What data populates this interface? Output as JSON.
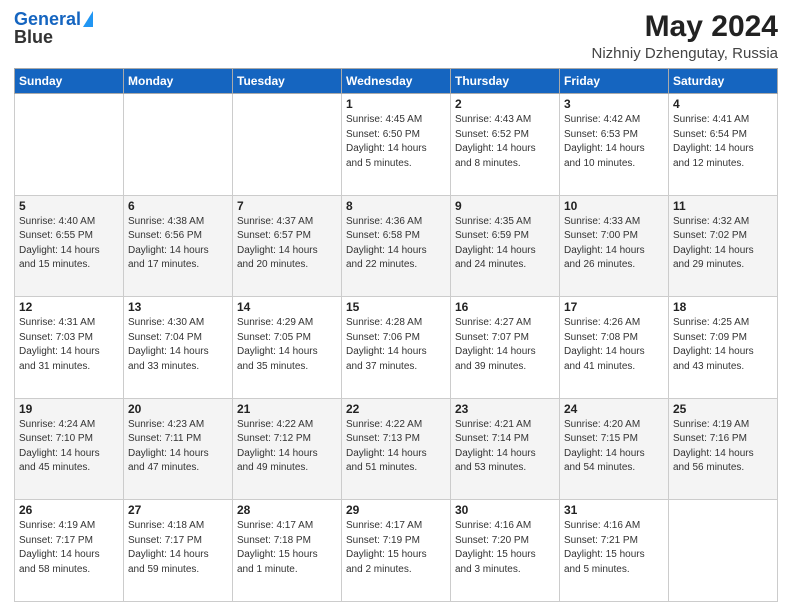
{
  "header": {
    "logo_general": "General",
    "logo_blue": "Blue",
    "month": "May 2024",
    "location": "Nizhniy Dzhengutay, Russia"
  },
  "weekdays": [
    "Sunday",
    "Monday",
    "Tuesday",
    "Wednesday",
    "Thursday",
    "Friday",
    "Saturday"
  ],
  "weeks": [
    [
      {
        "day": "",
        "info": ""
      },
      {
        "day": "",
        "info": ""
      },
      {
        "day": "",
        "info": ""
      },
      {
        "day": "1",
        "info": "Sunrise: 4:45 AM\nSunset: 6:50 PM\nDaylight: 14 hours\nand 5 minutes."
      },
      {
        "day": "2",
        "info": "Sunrise: 4:43 AM\nSunset: 6:52 PM\nDaylight: 14 hours\nand 8 minutes."
      },
      {
        "day": "3",
        "info": "Sunrise: 4:42 AM\nSunset: 6:53 PM\nDaylight: 14 hours\nand 10 minutes."
      },
      {
        "day": "4",
        "info": "Sunrise: 4:41 AM\nSunset: 6:54 PM\nDaylight: 14 hours\nand 12 minutes."
      }
    ],
    [
      {
        "day": "5",
        "info": "Sunrise: 4:40 AM\nSunset: 6:55 PM\nDaylight: 14 hours\nand 15 minutes."
      },
      {
        "day": "6",
        "info": "Sunrise: 4:38 AM\nSunset: 6:56 PM\nDaylight: 14 hours\nand 17 minutes."
      },
      {
        "day": "7",
        "info": "Sunrise: 4:37 AM\nSunset: 6:57 PM\nDaylight: 14 hours\nand 20 minutes."
      },
      {
        "day": "8",
        "info": "Sunrise: 4:36 AM\nSunset: 6:58 PM\nDaylight: 14 hours\nand 22 minutes."
      },
      {
        "day": "9",
        "info": "Sunrise: 4:35 AM\nSunset: 6:59 PM\nDaylight: 14 hours\nand 24 minutes."
      },
      {
        "day": "10",
        "info": "Sunrise: 4:33 AM\nSunset: 7:00 PM\nDaylight: 14 hours\nand 26 minutes."
      },
      {
        "day": "11",
        "info": "Sunrise: 4:32 AM\nSunset: 7:02 PM\nDaylight: 14 hours\nand 29 minutes."
      }
    ],
    [
      {
        "day": "12",
        "info": "Sunrise: 4:31 AM\nSunset: 7:03 PM\nDaylight: 14 hours\nand 31 minutes."
      },
      {
        "day": "13",
        "info": "Sunrise: 4:30 AM\nSunset: 7:04 PM\nDaylight: 14 hours\nand 33 minutes."
      },
      {
        "day": "14",
        "info": "Sunrise: 4:29 AM\nSunset: 7:05 PM\nDaylight: 14 hours\nand 35 minutes."
      },
      {
        "day": "15",
        "info": "Sunrise: 4:28 AM\nSunset: 7:06 PM\nDaylight: 14 hours\nand 37 minutes."
      },
      {
        "day": "16",
        "info": "Sunrise: 4:27 AM\nSunset: 7:07 PM\nDaylight: 14 hours\nand 39 minutes."
      },
      {
        "day": "17",
        "info": "Sunrise: 4:26 AM\nSunset: 7:08 PM\nDaylight: 14 hours\nand 41 minutes."
      },
      {
        "day": "18",
        "info": "Sunrise: 4:25 AM\nSunset: 7:09 PM\nDaylight: 14 hours\nand 43 minutes."
      }
    ],
    [
      {
        "day": "19",
        "info": "Sunrise: 4:24 AM\nSunset: 7:10 PM\nDaylight: 14 hours\nand 45 minutes."
      },
      {
        "day": "20",
        "info": "Sunrise: 4:23 AM\nSunset: 7:11 PM\nDaylight: 14 hours\nand 47 minutes."
      },
      {
        "day": "21",
        "info": "Sunrise: 4:22 AM\nSunset: 7:12 PM\nDaylight: 14 hours\nand 49 minutes."
      },
      {
        "day": "22",
        "info": "Sunrise: 4:22 AM\nSunset: 7:13 PM\nDaylight: 14 hours\nand 51 minutes."
      },
      {
        "day": "23",
        "info": "Sunrise: 4:21 AM\nSunset: 7:14 PM\nDaylight: 14 hours\nand 53 minutes."
      },
      {
        "day": "24",
        "info": "Sunrise: 4:20 AM\nSunset: 7:15 PM\nDaylight: 14 hours\nand 54 minutes."
      },
      {
        "day": "25",
        "info": "Sunrise: 4:19 AM\nSunset: 7:16 PM\nDaylight: 14 hours\nand 56 minutes."
      }
    ],
    [
      {
        "day": "26",
        "info": "Sunrise: 4:19 AM\nSunset: 7:17 PM\nDaylight: 14 hours\nand 58 minutes."
      },
      {
        "day": "27",
        "info": "Sunrise: 4:18 AM\nSunset: 7:17 PM\nDaylight: 14 hours\nand 59 minutes."
      },
      {
        "day": "28",
        "info": "Sunrise: 4:17 AM\nSunset: 7:18 PM\nDaylight: 15 hours\nand 1 minute."
      },
      {
        "day": "29",
        "info": "Sunrise: 4:17 AM\nSunset: 7:19 PM\nDaylight: 15 hours\nand 2 minutes."
      },
      {
        "day": "30",
        "info": "Sunrise: 4:16 AM\nSunset: 7:20 PM\nDaylight: 15 hours\nand 3 minutes."
      },
      {
        "day": "31",
        "info": "Sunrise: 4:16 AM\nSunset: 7:21 PM\nDaylight: 15 hours\nand 5 minutes."
      },
      {
        "day": "",
        "info": ""
      }
    ]
  ]
}
